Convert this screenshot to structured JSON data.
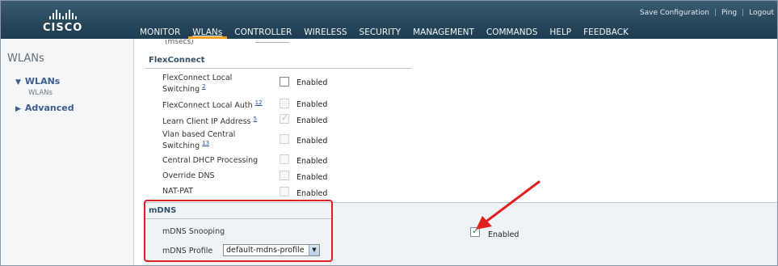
{
  "brand": {
    "name": "CISCO"
  },
  "top_links": [
    "Save Configuration",
    "Ping",
    "Logout"
  ],
  "nav": [
    "MONITOR",
    "WLANs",
    "CONTROLLER",
    "WIRELESS",
    "SECURITY",
    "MANAGEMENT",
    "COMMANDS",
    "HELP",
    "FEEDBACK"
  ],
  "sidebar": {
    "title": "WLANs",
    "items": [
      {
        "label": "WLANs",
        "expanded": true,
        "sub": "WLANs"
      },
      {
        "label": "Advanced",
        "expanded": false
      }
    ]
  },
  "content": {
    "partial_label": "(msecs)",
    "flex_section": "FlexConnect",
    "rows": [
      {
        "label_line1": "FlexConnect Local",
        "label_line2": "Switching",
        "note": "2",
        "checked": false,
        "disabled": false,
        "value": "Enabled"
      },
      {
        "label_line1": "FlexConnect Local Auth",
        "note": "12",
        "checked": false,
        "disabled": true,
        "value": "Enabled"
      },
      {
        "label_line1": "Learn Client IP Address",
        "note": "5",
        "checked": true,
        "disabled": true,
        "value": "Enabled"
      },
      {
        "label_line1": "Vlan based Central",
        "label_line2": "Switching",
        "note": "13",
        "checked": false,
        "disabled": true,
        "value": "Enabled"
      },
      {
        "label_line1": "Central DHCP Processing",
        "checked": false,
        "disabled": true,
        "value": "Enabled"
      },
      {
        "label_line1": "Override DNS",
        "checked": false,
        "disabled": true,
        "value": "Enabled"
      },
      {
        "label_line1": "NAT-PAT",
        "checked": false,
        "disabled": true,
        "value": "Enabled"
      }
    ],
    "mdns_section": "mDNS",
    "mdns_snooping": {
      "label": "mDNS Snooping",
      "checked": true,
      "value": "Enabled"
    },
    "mdns_profile": {
      "label": "mDNS Profile",
      "selected": "default-mdns-profile"
    }
  },
  "colors": {
    "header": "#27465a",
    "accent": "#f0a020",
    "highlight": "#e02020"
  }
}
